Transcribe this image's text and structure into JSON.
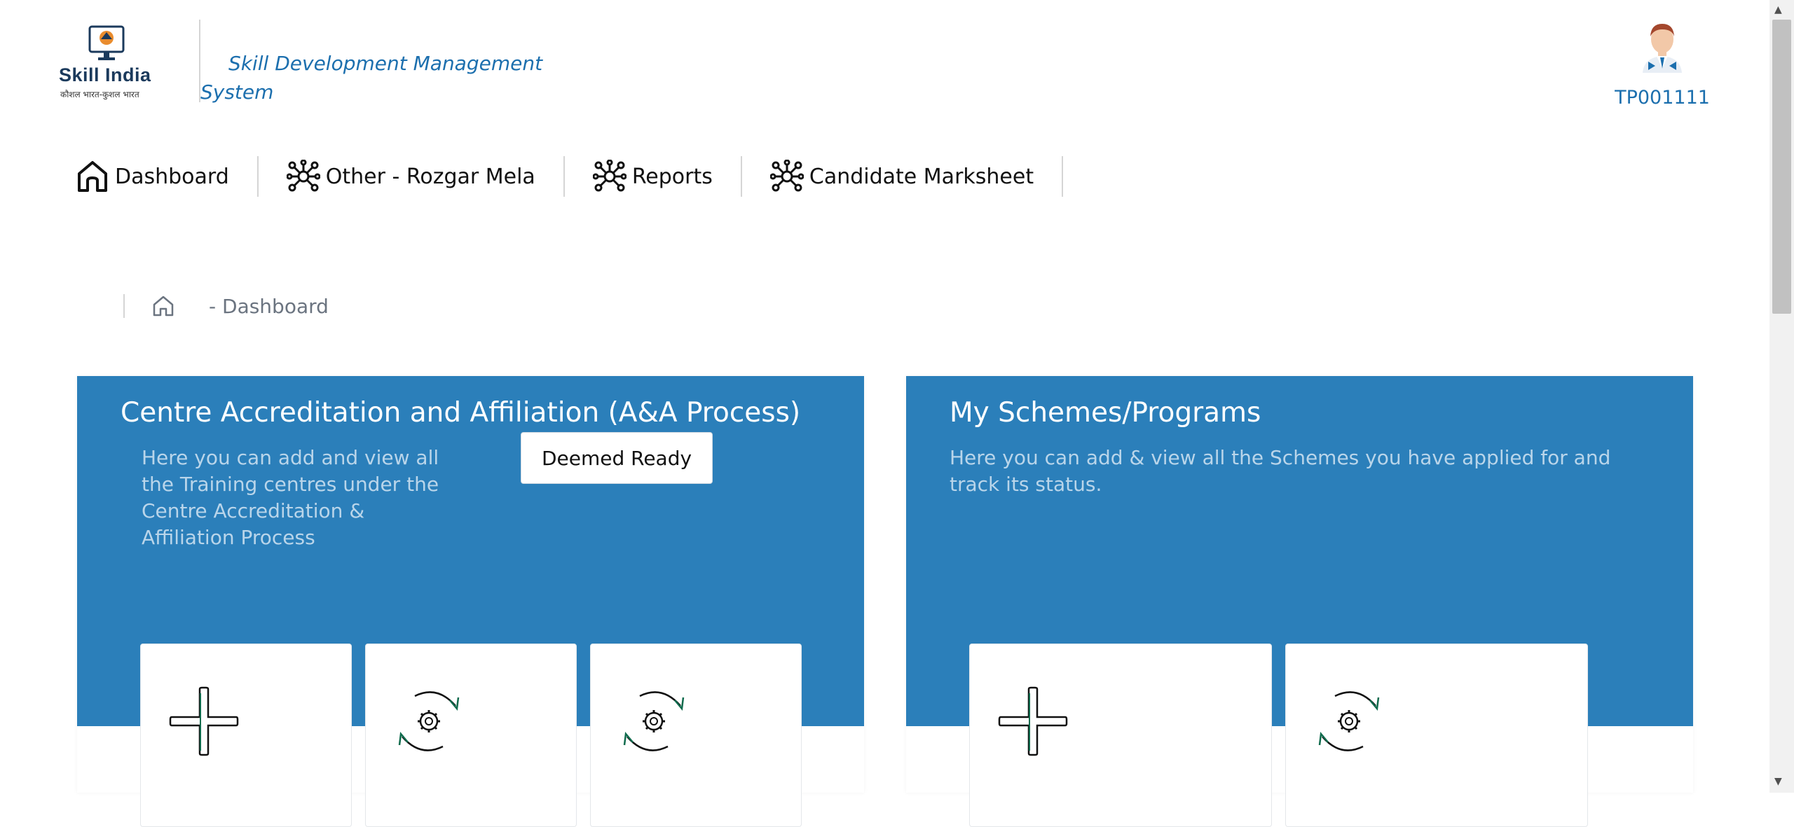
{
  "header": {
    "logo_title": "Skill India",
    "logo_subtitle": "कौशल भारत-कुशल भारत",
    "app_title": "Skill Development Management System",
    "user_id": "TP001111"
  },
  "nav": {
    "items": [
      {
        "label": "Dashboard",
        "icon": "home-icon"
      },
      {
        "label": "Other - Rozgar Mela",
        "icon": "network-icon"
      },
      {
        "label": "Reports",
        "icon": "network-icon"
      },
      {
        "label": "Candidate Marksheet",
        "icon": "network-icon"
      }
    ]
  },
  "breadcrumb": {
    "text": "-  Dashboard"
  },
  "cards": {
    "aa": {
      "title": "Centre Accreditation and Affiliation (A&A Process)",
      "description": "Here you can add and view all the Training centres under the Centre Accreditation & Affiliation Process",
      "badge_button": "Deemed Ready",
      "tiles": [
        "plus-icon",
        "refresh-gear-icon",
        "refresh-gear-icon"
      ]
    },
    "schemes": {
      "title": "My Schemes/Programs",
      "description": "Here you can add & view all the Schemes you have applied for and track its status.",
      "tiles": [
        "plus-icon",
        "refresh-gear-icon"
      ]
    }
  },
  "colors": {
    "card_header": "#2b7fba",
    "title_blue": "#1c6fae",
    "description_text": "#b9d5ea"
  }
}
